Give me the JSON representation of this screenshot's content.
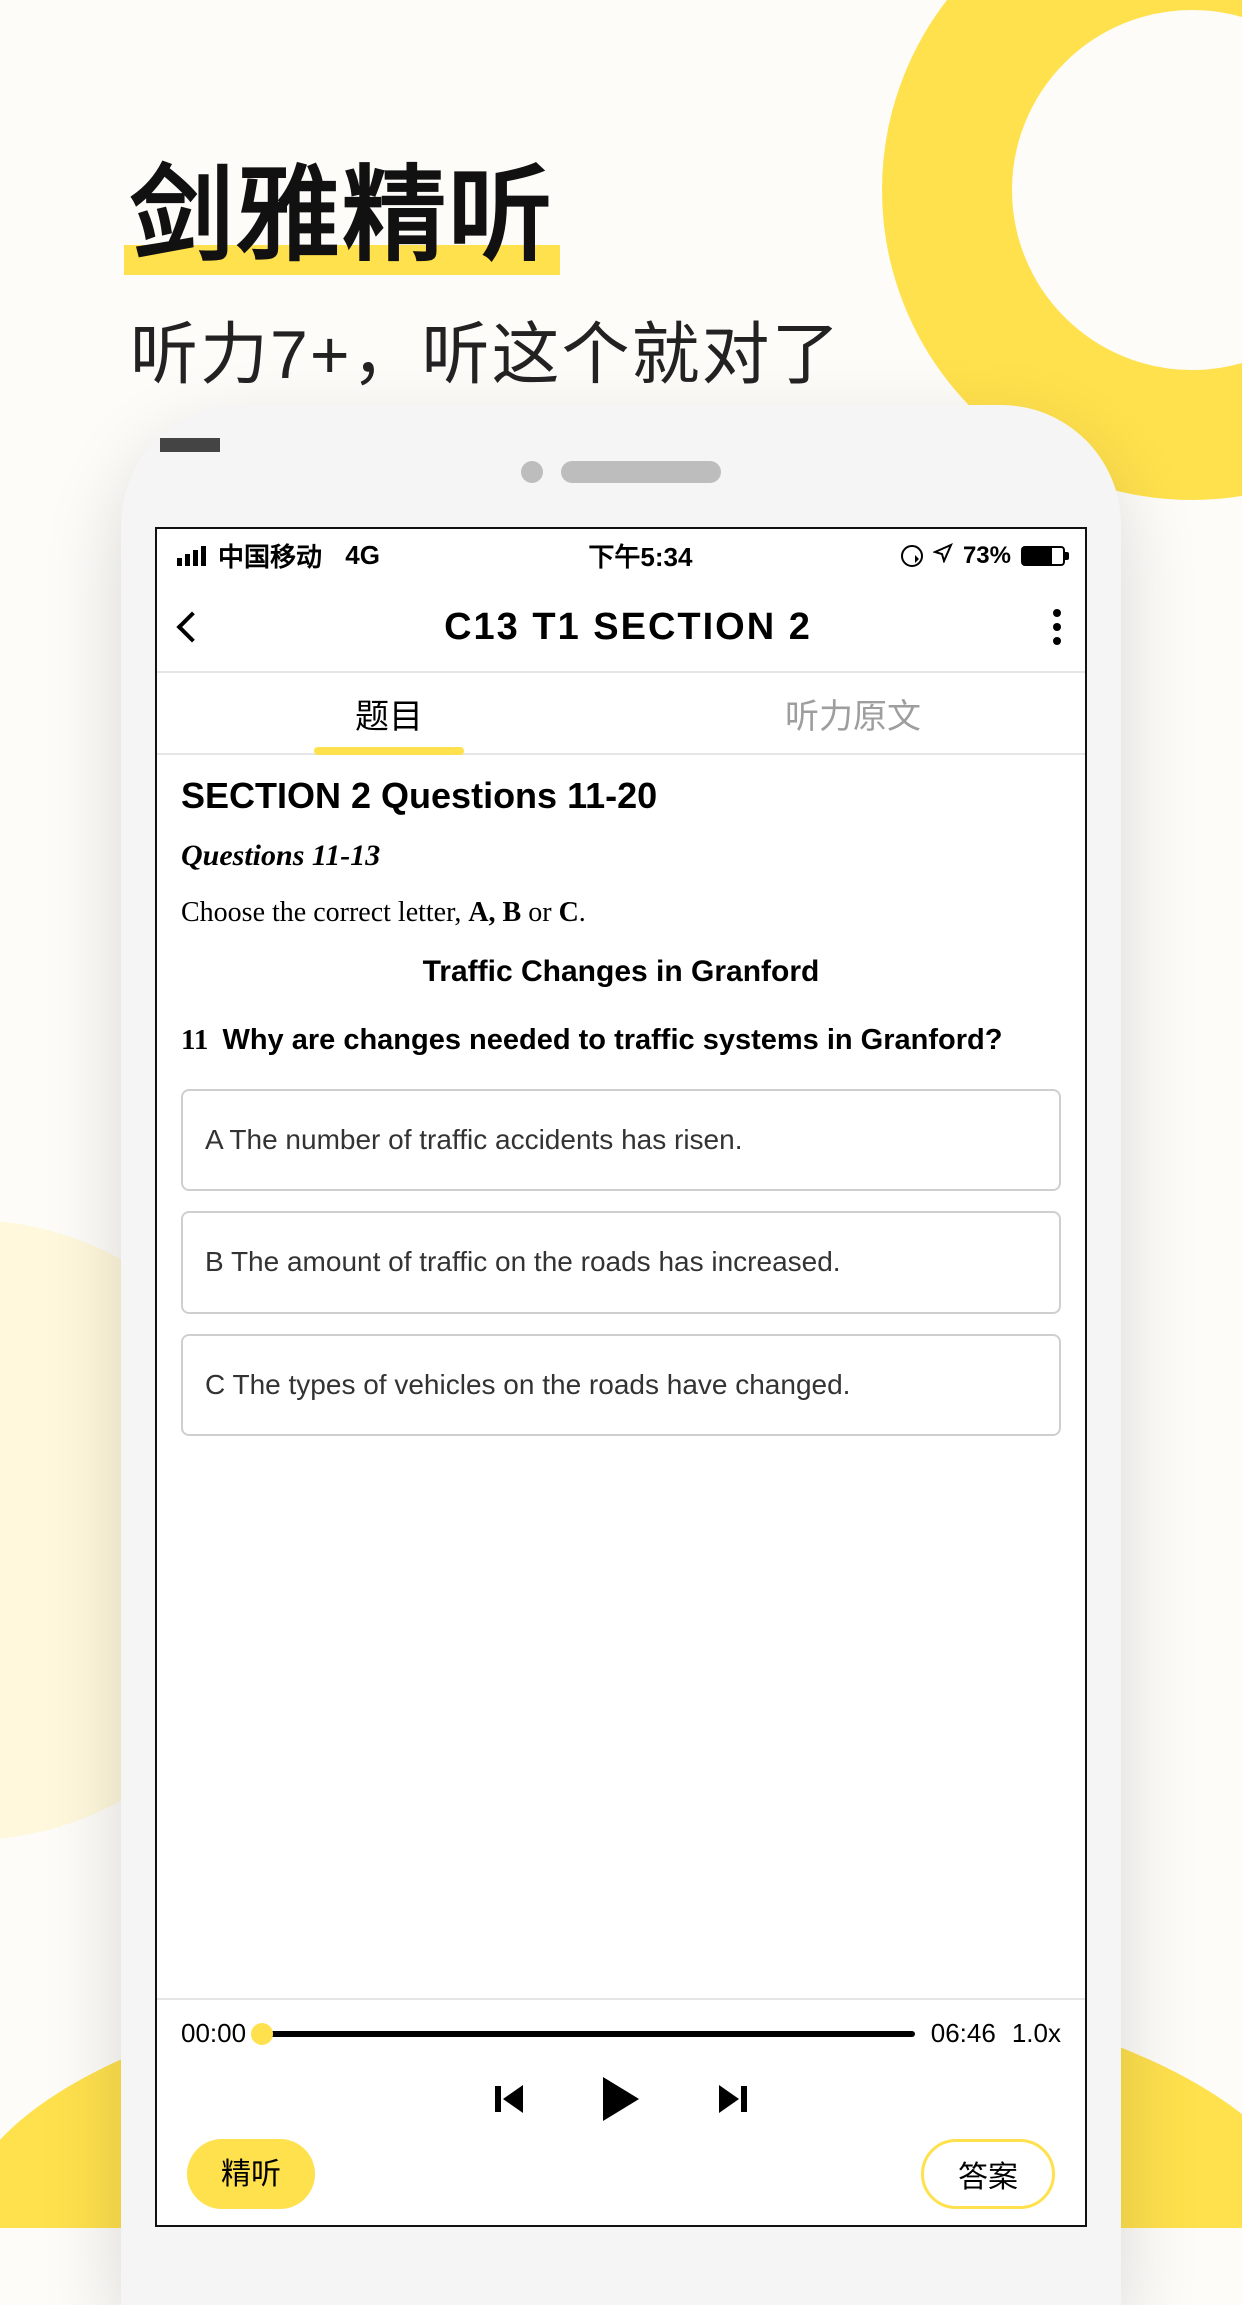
{
  "hero": {
    "title": "剑雅精听",
    "subtitle": "听力7+，听这个就对了"
  },
  "status": {
    "carrier": "中国移动",
    "network": "4G",
    "time": "下午5:34",
    "battery_pct": "73%"
  },
  "nav": {
    "title": "C13  T1  SECTION 2"
  },
  "tabs": {
    "questions": "题目",
    "transcript": "听力原文"
  },
  "content": {
    "section_heading": "SECTION 2 Questions 11-20",
    "sub_heading": "Questions 11-13",
    "instruction_prefix": "Choose the correct letter, ",
    "instruction_bold": "A, B",
    "instruction_mid": " or ",
    "instruction_bold2": "C",
    "instruction_suffix": ".",
    "topic": "Traffic Changes in Granford",
    "q_number": "11",
    "q_text": "Why are changes needed to traffic systems in Granford?",
    "options": [
      "A The number of traffic accidents has risen.",
      "B The amount of traffic on the roads has increased.",
      "C The types of vehicles on the roads have changed."
    ]
  },
  "player": {
    "current": "00:00",
    "total": "06:46",
    "speed": "1.0x"
  },
  "buttons": {
    "jingting": "精听",
    "answer": "答案"
  }
}
